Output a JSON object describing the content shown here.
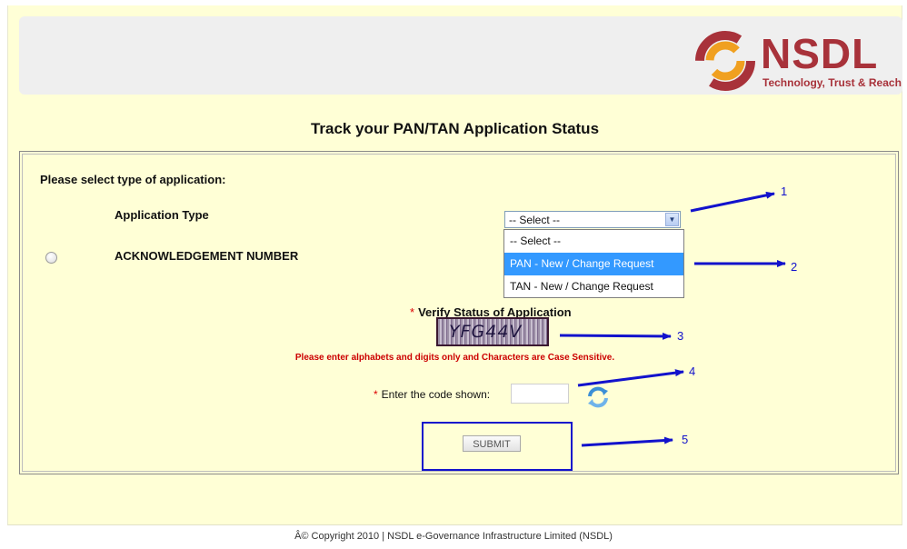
{
  "header": {
    "logo_text": "NSDL",
    "logo_tagline": "Technology, Trust & Reach",
    "brand_color": "#a8323a"
  },
  "title": "Track your PAN/TAN Application Status",
  "form": {
    "select_type_prompt": "Please select type of application:",
    "application_type_label": "Application Type",
    "application_type_value": "-- Select --",
    "application_type_options": [
      "-- Select --",
      "PAN - New / Change Request",
      "TAN - New / Change Request"
    ],
    "highlighted_option": "PAN - New / Change Request",
    "ack_label": "ACKNOWLEDGEMENT NUMBER",
    "required_mark": "*",
    "verify_label": "Verify Status of Application",
    "captcha_text": "YFG44V",
    "warning": "Please enter alphabets and digits only and Characters are Case Sensitive.",
    "code_label": "Enter the code shown:",
    "code_value": "",
    "submit_label": "SUBMIT"
  },
  "annotations": [
    "1",
    "2",
    "3",
    "4",
    "5"
  ],
  "footer": "Â© Copyright 2010  |  NSDL e-Governance Infrastructure Limited (NSDL)"
}
